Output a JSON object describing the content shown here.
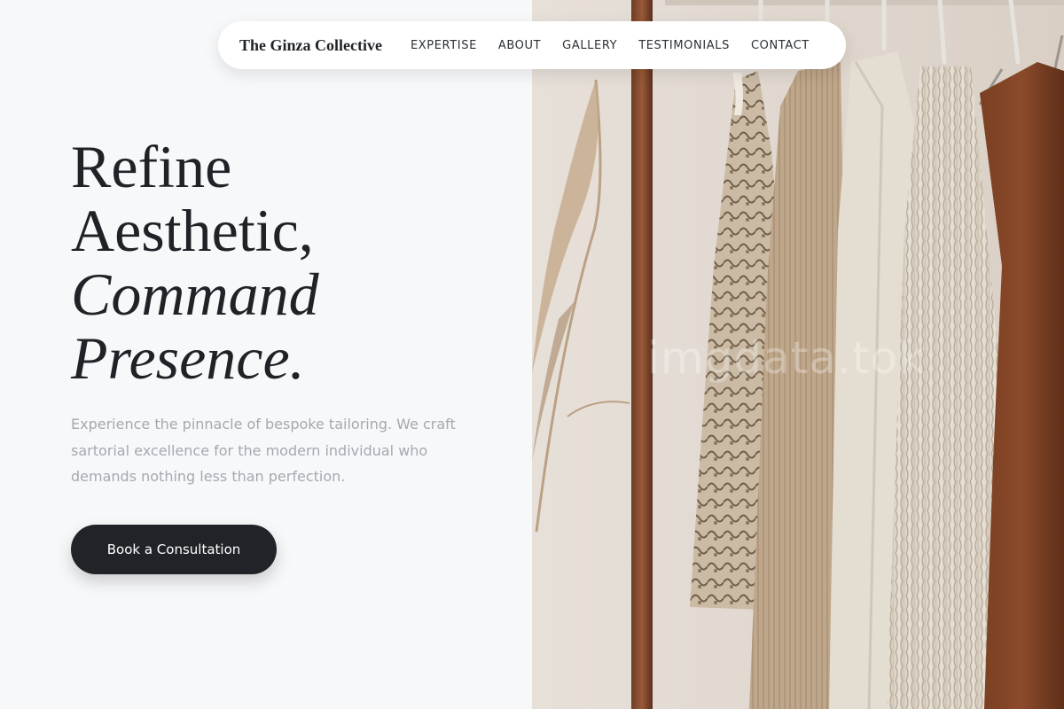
{
  "nav": {
    "brand": "The Ginza Collective",
    "links": [
      "EXPERTISE",
      "ABOUT",
      "GALLERY",
      "TESTIMONIALS",
      "CONTACT"
    ]
  },
  "hero": {
    "headline_line1": "Refine",
    "headline_line2": "Aesthetic,",
    "headline_line3": "Command",
    "headline_line4": "Presence.",
    "description": "Experience the pinnacle of bespoke tailoring. We craft sartorial excellence for the modern individual who demands nothing less than perfection.",
    "cta_label": "Book a Consultation"
  },
  "image": {
    "subject": "clothing rack with knitwear and pampas grass",
    "watermark": "imgdata.tok"
  },
  "colors": {
    "background": "#f7f8fa",
    "text_primary": "#1f2328",
    "text_muted": "#a4a9b0",
    "button_bg": "#202327",
    "button_text": "#ffffff"
  }
}
